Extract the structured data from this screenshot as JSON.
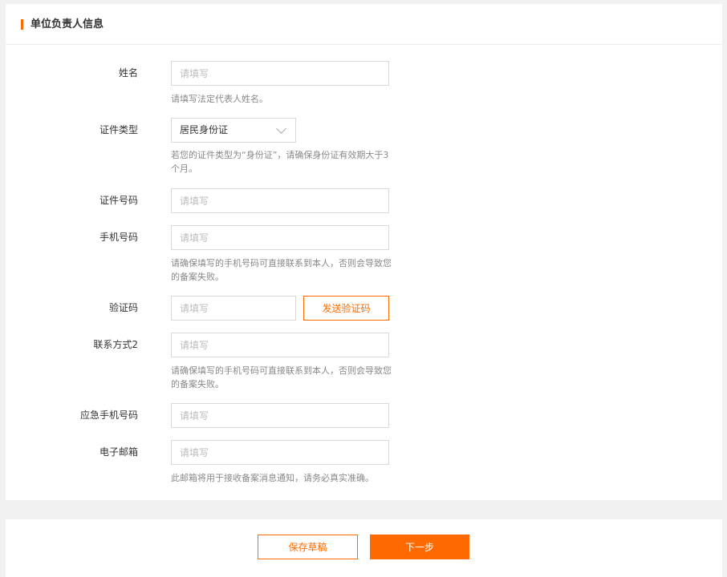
{
  "section": {
    "title": "单位负责人信息"
  },
  "fields": {
    "name": {
      "label": "姓名",
      "placeholder": "请填写",
      "hint": "请填写法定代表人姓名。"
    },
    "id_type": {
      "label": "证件类型",
      "value": "居民身份证",
      "hint": "若您的证件类型为“身份证”，请确保身份证有效期大于3个月。"
    },
    "id_number": {
      "label": "证件号码",
      "placeholder": "请填写"
    },
    "phone": {
      "label": "手机号码",
      "placeholder": "请填写",
      "hint": "请确保填写的手机号码可直接联系到本人，否则会导致您的备案失败。"
    },
    "code": {
      "label": "验证码",
      "placeholder": "请填写",
      "send_label": "发送验证码"
    },
    "contact2": {
      "label": "联系方式2",
      "placeholder": "请填写",
      "hint": "请确保填写的手机号码可直接联系到本人，否则会导致您的备案失败。"
    },
    "emergency_phone": {
      "label": "应急手机号码",
      "placeholder": "请填写"
    },
    "email": {
      "label": "电子邮箱",
      "placeholder": "请填写",
      "hint": "此邮箱将用于接收备案消息通知，请务必真实准确。"
    }
  },
  "footer": {
    "save_draft_label": "保存草稿",
    "next_label": "下一步"
  },
  "colors": {
    "accent": "#ff6a00",
    "hint_text": "#888888",
    "border": "#d9d9d9"
  }
}
